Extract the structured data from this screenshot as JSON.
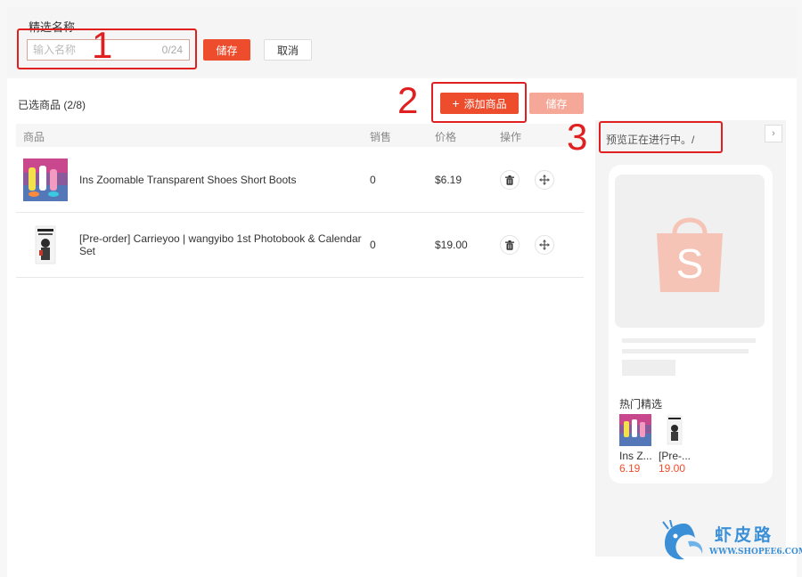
{
  "form": {
    "field_label": "精选名称",
    "name_placeholder": "输入名称",
    "name_value": "",
    "name_counter": "0/24",
    "save_label": "储存",
    "cancel_label": "取消"
  },
  "products": {
    "selected_label": "已选商品 (2/8)",
    "add_label": "添加商品",
    "save_label": "储存",
    "columns": [
      "商品",
      "销售",
      "价格",
      "操作"
    ],
    "rows": [
      {
        "name": "Ins Zoomable Transparent Shoes Short Boots",
        "sales": "0",
        "price": "$6.19"
      },
      {
        "name": "[Pre-order] Carrieyoo | wangyibo 1st Photobook & Calendar Set",
        "sales": "0",
        "price": "$19.00"
      }
    ]
  },
  "preview": {
    "status_text": "预览正在进行中。/",
    "hot_title": "热门精选",
    "items": [
      {
        "name": "Ins Z...",
        "price": "6.19"
      },
      {
        "name": "[Pre-...",
        "price": "19.00"
      }
    ]
  },
  "annotations": [
    "1",
    "2",
    "3"
  ],
  "watermark": {
    "title": "虾皮路",
    "url": "WWW.SHOPEE6.COM"
  },
  "colors": {
    "accent": "#ee4d2d",
    "accent_disabled": "#f5a897",
    "annotation": "#e02020",
    "watermark": "#3a8fd6"
  }
}
